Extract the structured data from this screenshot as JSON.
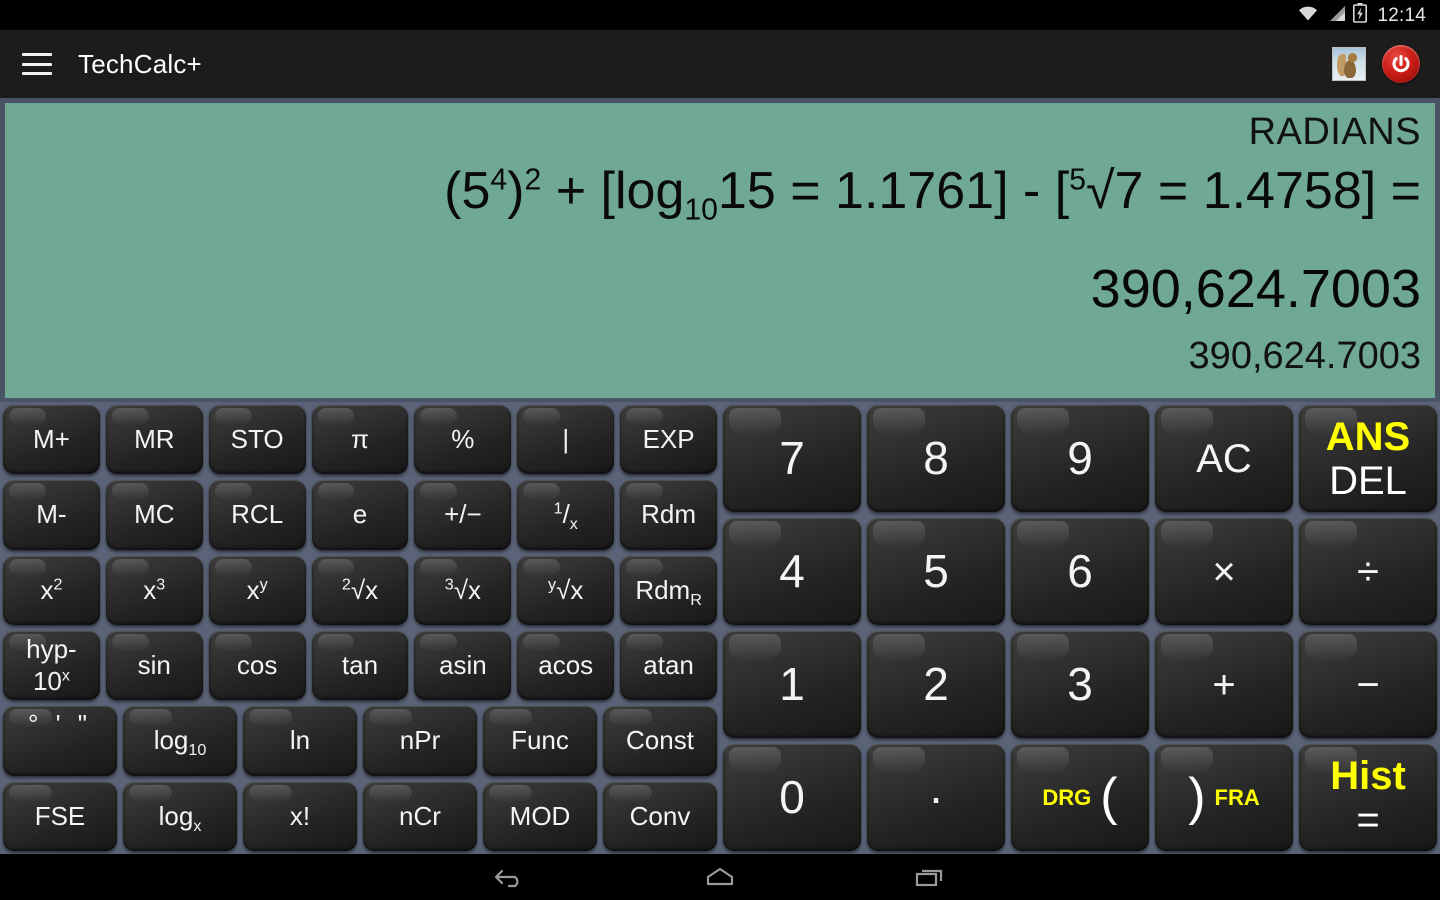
{
  "statusbar": {
    "time": "12:14",
    "icons": [
      "wifi-icon",
      "signal-icon",
      "battery-charging-icon"
    ]
  },
  "appbar": {
    "menu_icon": "hamburger-menu-icon",
    "title": "TechCalc+",
    "photo_icon": "squirrel-photo-icon",
    "power_icon": "power-icon"
  },
  "display": {
    "angle_mode": "RADIANS",
    "expression_plain": "(5^4)^2 + [log_10 15 = 1.1761] - [5√7 = 1.4758] =",
    "expression_parts": {
      "base1": "(5",
      "sup1": "4",
      "mid1": ")",
      "sup2": "2",
      "mid2": " + [log",
      "sub1": "10",
      "mid3": "15 = 1.1761] - [",
      "sup3": "5",
      "mid4": "√7 = 1.4758] ="
    },
    "result_main": "390,624.7003",
    "result_secondary": "390,624.7003",
    "background_color": "#6fa893",
    "text_color": "#0a0a0a"
  },
  "keypad": {
    "accent_color": "#ffff00",
    "key_color": "#262626",
    "background_color": "#5a6377",
    "left_rows": [
      [
        {
          "label": "M+",
          "name": "key-memory-add"
        },
        {
          "label": "MR",
          "name": "key-memory-recall"
        },
        {
          "label": "STO",
          "name": "key-store"
        },
        {
          "label": "π",
          "name": "key-pi"
        },
        {
          "label": "%",
          "name": "key-percent"
        },
        {
          "label": "|",
          "name": "key-abs"
        },
        {
          "label": "EXP",
          "name": "key-exp"
        }
      ],
      [
        {
          "label": "M-",
          "name": "key-memory-subtract"
        },
        {
          "label": "MC",
          "name": "key-memory-clear"
        },
        {
          "label": "RCL",
          "name": "key-recall"
        },
        {
          "label": "e",
          "name": "key-e"
        },
        {
          "label": "+/−",
          "name": "key-sign-toggle"
        },
        {
          "html": "<sup>1</sup>/<sub>x</sub>",
          "name": "key-reciprocal"
        },
        {
          "label": "Rdm",
          "name": "key-random"
        }
      ],
      [
        {
          "html": "x<sup>2</sup>",
          "name": "key-square"
        },
        {
          "html": "x<sup>3</sup>",
          "name": "key-cube"
        },
        {
          "html": "x<sup>y</sup>",
          "name": "key-power"
        },
        {
          "html": "<sup>2</sup>√x",
          "name": "key-square-root"
        },
        {
          "html": "<sup>3</sup>√x",
          "name": "key-cube-root"
        },
        {
          "html": "<sup>y</sup>√x",
          "name": "key-nth-root"
        },
        {
          "html": "Rdm<sub>R</sub>",
          "name": "key-random-range"
        }
      ],
      [
        {
          "stack": [
            "hyp-",
            "10<sup>x</sup>"
          ],
          "name": "key-hyp-ten-power"
        },
        {
          "label": "sin",
          "name": "key-sin"
        },
        {
          "label": "cos",
          "name": "key-cos"
        },
        {
          "label": "tan",
          "name": "key-tan"
        },
        {
          "label": "asin",
          "name": "key-asin"
        },
        {
          "label": "acos",
          "name": "key-acos"
        },
        {
          "label": "atan",
          "name": "key-atan"
        }
      ],
      [
        {
          "dms": "° ' \"",
          "name": "key-degrees-minutes-seconds"
        },
        {
          "html": "log<sub>10</sub>",
          "name": "key-log10"
        },
        {
          "label": "ln",
          "name": "key-ln"
        },
        {
          "label": "nPr",
          "name": "key-permutation"
        },
        {
          "label": "Func",
          "name": "key-func"
        },
        {
          "label": "Const",
          "name": "key-const"
        }
      ],
      [
        {
          "label": "FSE",
          "name": "key-fse"
        },
        {
          "html": "log<sub>x</sub>",
          "name": "key-log-base-x"
        },
        {
          "label": "x!",
          "name": "key-factorial"
        },
        {
          "label": "nCr",
          "name": "key-combination"
        },
        {
          "label": "MOD",
          "name": "key-mod"
        },
        {
          "label": "Conv",
          "name": "key-conv"
        }
      ]
    ],
    "right_rows": [
      [
        {
          "label": "7",
          "name": "key-7"
        },
        {
          "label": "8",
          "name": "key-8"
        },
        {
          "label": "9",
          "name": "key-9"
        },
        {
          "label": "AC",
          "name": "key-all-clear",
          "kind": "small"
        },
        {
          "dual": {
            "top": "ANS",
            "bottom": "DEL"
          },
          "name": "key-ans-del"
        }
      ],
      [
        {
          "label": "4",
          "name": "key-4"
        },
        {
          "label": "5",
          "name": "key-5"
        },
        {
          "label": "6",
          "name": "key-6"
        },
        {
          "label": "×",
          "name": "key-multiply",
          "kind": "op"
        },
        {
          "label": "÷",
          "name": "key-divide",
          "kind": "op"
        }
      ],
      [
        {
          "label": "1",
          "name": "key-1"
        },
        {
          "label": "2",
          "name": "key-2"
        },
        {
          "label": "3",
          "name": "key-3"
        },
        {
          "label": "+",
          "name": "key-plus",
          "kind": "op"
        },
        {
          "label": "−",
          "name": "key-minus",
          "kind": "op"
        }
      ],
      [
        {
          "label": "0",
          "name": "key-0"
        },
        {
          "label": "·",
          "name": "key-decimal-point",
          "kind": "dot"
        },
        {
          "inline": {
            "tag": "DRG",
            "paren": "(",
            "tag_side": "left"
          },
          "name": "key-drg-open-paren"
        },
        {
          "inline": {
            "tag": "FRA",
            "paren": ")",
            "tag_side": "right"
          },
          "name": "key-fra-close-paren"
        },
        {
          "dual": {
            "top": "Hist",
            "bottom": "="
          },
          "name": "key-hist-equals"
        }
      ]
    ]
  },
  "navbar": {
    "back": "back-icon",
    "home": "home-icon",
    "recents": "recents-icon"
  }
}
